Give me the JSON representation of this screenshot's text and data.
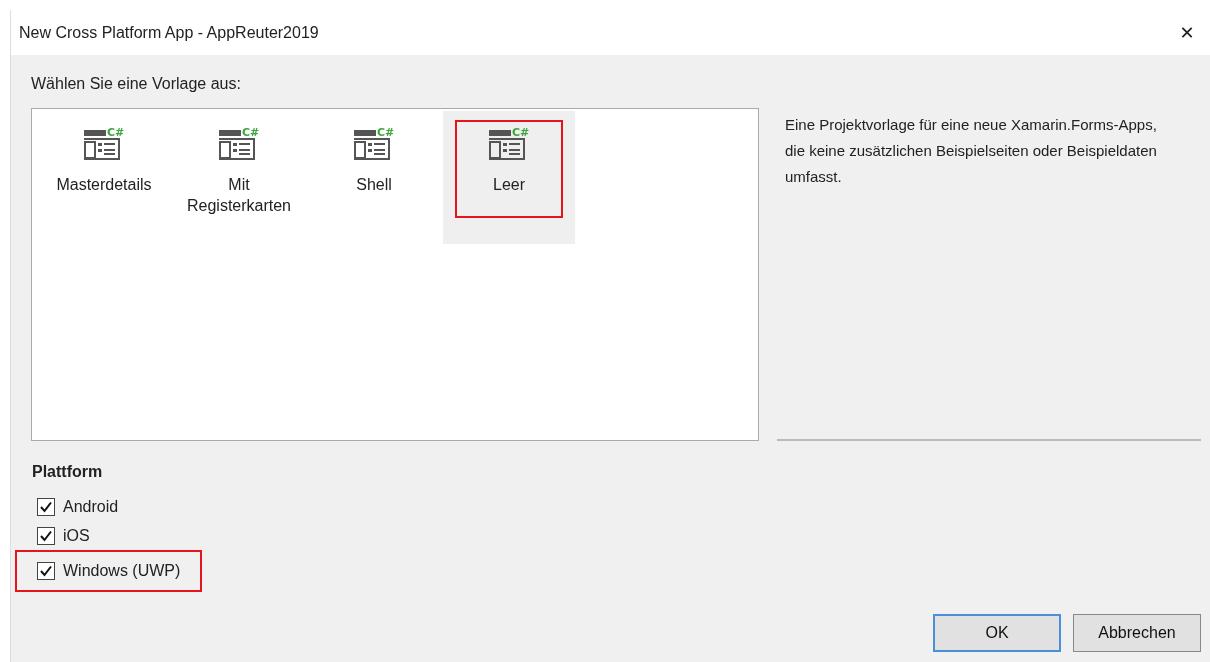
{
  "window": {
    "title": "New Cross Platform App - AppReuter2019",
    "close": "✕"
  },
  "template_prompt": "Wählen Sie eine Vorlage aus:",
  "templates": [
    {
      "label": "Masterdetails",
      "badge": "C#",
      "selected": false,
      "highlighted": false
    },
    {
      "label": "Mit Registerkarten",
      "badge": "C#",
      "selected": false,
      "highlighted": false
    },
    {
      "label": "Shell",
      "badge": "C#",
      "selected": false,
      "highlighted": false
    },
    {
      "label": "Leer",
      "badge": "C#",
      "selected": true,
      "highlighted": true
    }
  ],
  "description": "Eine Projektvorlage für eine neue Xamarin.Forms-Apps, die keine zusätzlichen Beispielseiten oder Beispieldaten umfasst.",
  "platform": {
    "heading": "Plattform",
    "options": [
      {
        "label": "Android",
        "checked": true,
        "highlighted": false
      },
      {
        "label": "iOS",
        "checked": true,
        "highlighted": false
      },
      {
        "label": "Windows (UWP)",
        "checked": true,
        "highlighted": true
      }
    ]
  },
  "buttons": [
    {
      "label": "OK",
      "kind": "default"
    },
    {
      "label": "Abbrechen",
      "kind": "normal"
    }
  ]
}
